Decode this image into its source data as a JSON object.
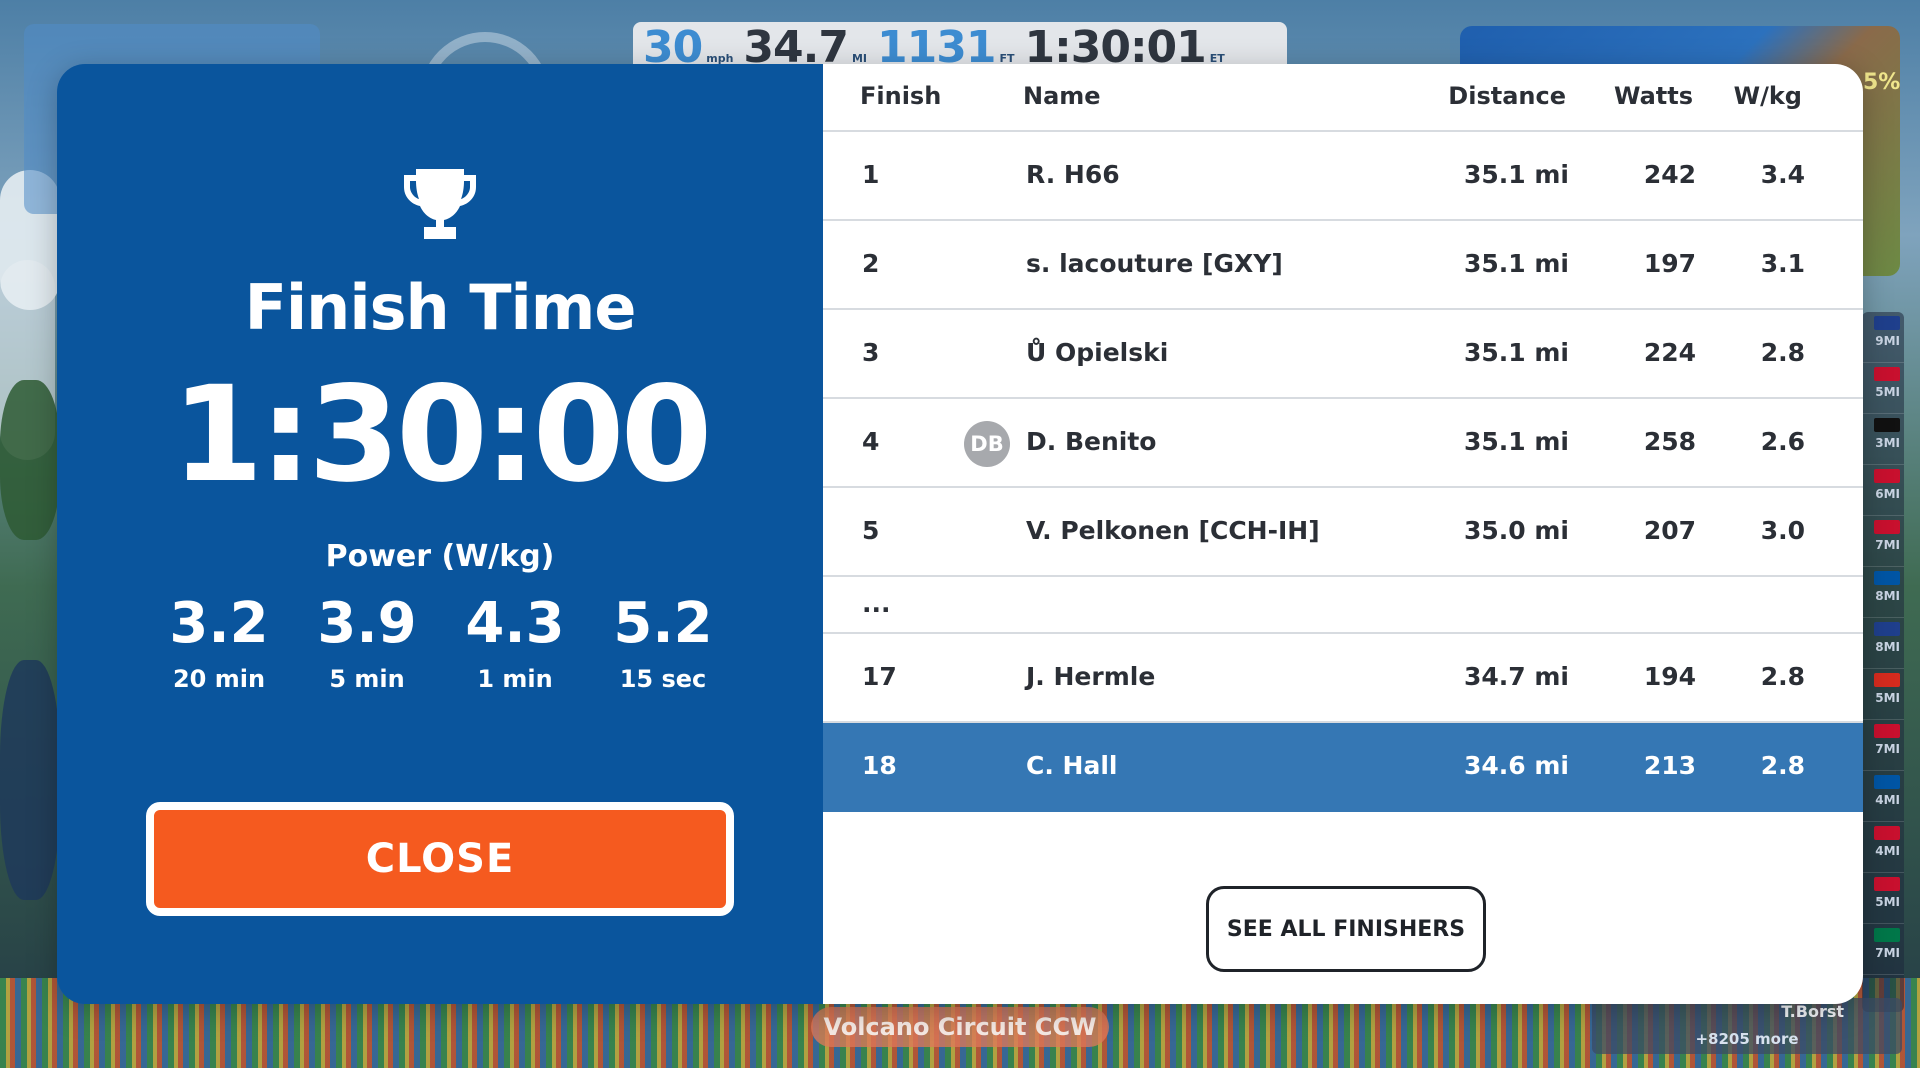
{
  "hud": {
    "speed": "30",
    "speed_unit": "mph",
    "distance": "34.7",
    "distance_unit": "MI",
    "elevation": "1131",
    "elevation_unit": "FT",
    "time": "1:30:01",
    "time_unit": "ET"
  },
  "route_name": "Volcano Circuit CCW",
  "minimap": {
    "gradient": "5%"
  },
  "side_leaderboard": {
    "items": [
      {
        "flag_color": "#1f3f8c",
        "dist": "9MI"
      },
      {
        "flag_color": "#c8102e",
        "dist": "5MI"
      },
      {
        "flag_color": "#111111",
        "dist": "3MI"
      },
      {
        "flag_color": "#c8102e",
        "dist": "6MI"
      },
      {
        "flag_color": "#c8102e",
        "dist": "7MI"
      },
      {
        "flag_color": "#0055a4",
        "dist": "8MI"
      },
      {
        "flag_color": "#1f3f8c",
        "dist": "8MI"
      },
      {
        "flag_color": "#d52b1e",
        "dist": "5MI"
      },
      {
        "flag_color": "#c8102e",
        "dist": "7MI"
      },
      {
        "flag_color": "#0055a4",
        "dist": "4MI"
      },
      {
        "flag_color": "#c8102e",
        "dist": "4MI"
      },
      {
        "flag_color": "#c8102e",
        "dist": "5MI"
      },
      {
        "flag_color": "#007749",
        "dist": "7MI"
      }
    ],
    "last_name": "T.Borst",
    "more": "+8205 more"
  },
  "modal": {
    "title": "Finish Time",
    "finish_time": "1:30:00",
    "power_label": "Power (W/kg)",
    "power": [
      {
        "value": "3.2",
        "duration": "20 min"
      },
      {
        "value": "3.9",
        "duration": "5 min"
      },
      {
        "value": "4.3",
        "duration": "1 min"
      },
      {
        "value": "5.2",
        "duration": "15 sec"
      }
    ],
    "close_label": "CLOSE",
    "see_all_label": "SEE ALL FINISHERS",
    "table": {
      "headers": {
        "finish": "Finish",
        "name": "Name",
        "distance": "Distance",
        "watts": "Watts",
        "wkg": "W/kg"
      },
      "rows": [
        {
          "finish": "1",
          "name": "R. H66",
          "distance": "35.1 mi",
          "watts": "242",
          "wkg": "3.4"
        },
        {
          "finish": "2",
          "name": "s. lacouture [GXY]",
          "distance": "35.1 mi",
          "watts": "197",
          "wkg": "3.1"
        },
        {
          "finish": "3",
          "name": "Ů Opielski",
          "distance": "35.1 mi",
          "watts": "224",
          "wkg": "2.8"
        },
        {
          "finish": "4",
          "name": "D. Benito",
          "distance": "35.1 mi",
          "watts": "258",
          "wkg": "2.6",
          "avatar": "DB"
        },
        {
          "finish": "5",
          "name": "V. Pelkonen [CCH-IH]",
          "distance": "35.0 mi",
          "watts": "207",
          "wkg": "3.0"
        }
      ],
      "ellipsis": "...",
      "tail_rows": [
        {
          "finish": "17",
          "name": "J. Hermle",
          "distance": "34.7 mi",
          "watts": "194",
          "wkg": "2.8"
        },
        {
          "finish": "18",
          "name": "C. Hall",
          "distance": "34.6 mi",
          "watts": "213",
          "wkg": "2.8"
        }
      ]
    }
  },
  "colors": {
    "panel_blue": "#0a559d",
    "close_orange": "#f55a1f",
    "highlight_row": "#3577b4"
  }
}
